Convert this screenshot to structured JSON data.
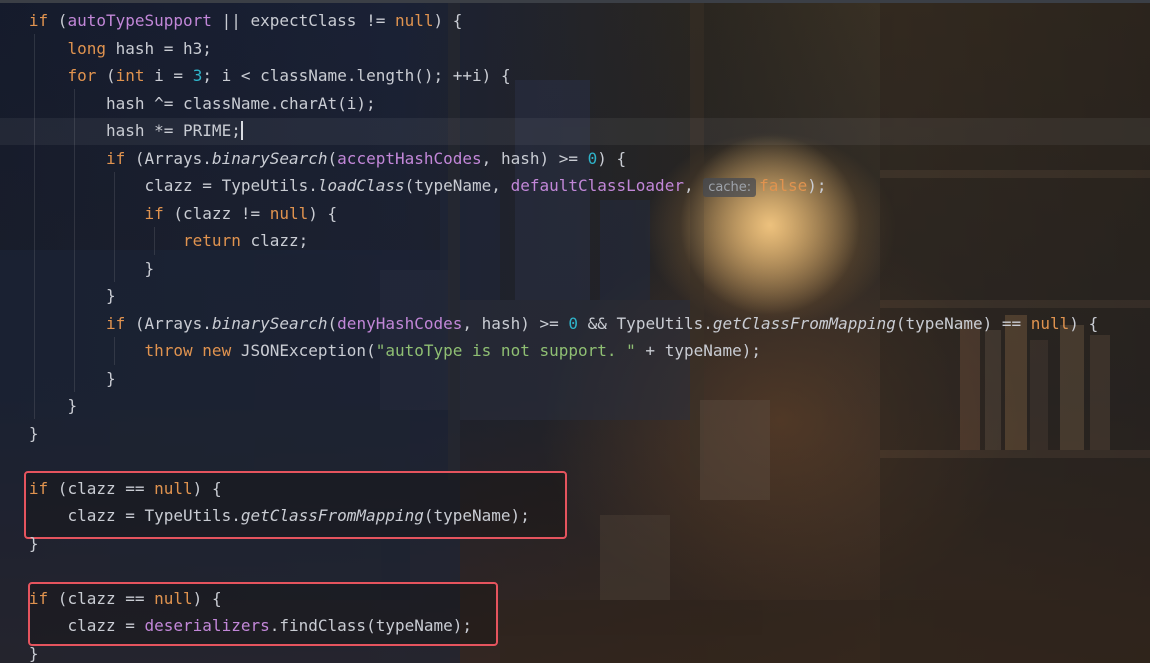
{
  "editor": {
    "highlight_color": "#e5545e",
    "lines": [
      [
        {
          "t": "if",
          "c": "kw"
        },
        {
          "t": " (",
          "c": "plain"
        },
        {
          "t": "autoTypeSupport",
          "c": "fld"
        },
        {
          "t": " || expectClass != ",
          "c": "plain"
        },
        {
          "t": "null",
          "c": "kw"
        },
        {
          "t": ") {",
          "c": "plain"
        }
      ],
      [
        {
          "t": "    ",
          "c": "plain"
        },
        {
          "t": "long",
          "c": "kw"
        },
        {
          "t": " hash = h3;",
          "c": "plain"
        }
      ],
      [
        {
          "t": "    ",
          "c": "plain"
        },
        {
          "t": "for",
          "c": "kw"
        },
        {
          "t": " (",
          "c": "plain"
        },
        {
          "t": "int",
          "c": "kw"
        },
        {
          "t": " i = ",
          "c": "plain"
        },
        {
          "t": "3",
          "c": "num"
        },
        {
          "t": "; i < className.length(); ++i) {",
          "c": "plain"
        }
      ],
      [
        {
          "t": "        hash ^= className.charAt(i);",
          "c": "plain"
        }
      ],
      [
        {
          "t": "        hash *= PRIME;",
          "c": "plain"
        },
        {
          "caret": true
        }
      ],
      [
        {
          "t": "        ",
          "c": "plain"
        },
        {
          "t": "if",
          "c": "kw"
        },
        {
          "t": " (Arrays.",
          "c": "plain"
        },
        {
          "t": "binarySearch",
          "c": "it"
        },
        {
          "t": "(",
          "c": "plain"
        },
        {
          "t": "acceptHashCodes",
          "c": "fld"
        },
        {
          "t": ", hash) >= ",
          "c": "plain"
        },
        {
          "t": "0",
          "c": "num"
        },
        {
          "t": ") {",
          "c": "plain"
        }
      ],
      [
        {
          "t": "            clazz = TypeUtils.",
          "c": "plain"
        },
        {
          "t": "loadClass",
          "c": "it"
        },
        {
          "t": "(typeName, ",
          "c": "plain"
        },
        {
          "t": "defaultClassLoader",
          "c": "fld"
        },
        {
          "t": ", ",
          "c": "plain"
        },
        {
          "hint": "cache:"
        },
        {
          "t": "false",
          "c": "kw"
        },
        {
          "t": ");",
          "c": "plain"
        }
      ],
      [
        {
          "t": "            ",
          "c": "plain"
        },
        {
          "t": "if",
          "c": "kw"
        },
        {
          "t": " (clazz != ",
          "c": "plain"
        },
        {
          "t": "null",
          "c": "kw"
        },
        {
          "t": ") {",
          "c": "plain"
        }
      ],
      [
        {
          "t": "                ",
          "c": "plain"
        },
        {
          "t": "return",
          "c": "kw"
        },
        {
          "t": " clazz;",
          "c": "plain"
        }
      ],
      [
        {
          "t": "            }",
          "c": "plain"
        }
      ],
      [
        {
          "t": "        }",
          "c": "plain"
        }
      ],
      [
        {
          "t": "        ",
          "c": "plain"
        },
        {
          "t": "if",
          "c": "kw"
        },
        {
          "t": " (Arrays.",
          "c": "plain"
        },
        {
          "t": "binarySearch",
          "c": "it"
        },
        {
          "t": "(",
          "c": "plain"
        },
        {
          "t": "denyHashCodes",
          "c": "fld"
        },
        {
          "t": ", hash) >= ",
          "c": "plain"
        },
        {
          "t": "0",
          "c": "num"
        },
        {
          "t": " && TypeUtils.",
          "c": "plain"
        },
        {
          "t": "getClassFromMapping",
          "c": "it"
        },
        {
          "t": "(typeName) == ",
          "c": "plain"
        },
        {
          "t": "null",
          "c": "kw"
        },
        {
          "t": ") {",
          "c": "plain"
        }
      ],
      [
        {
          "t": "            ",
          "c": "plain"
        },
        {
          "t": "throw new",
          "c": "kw"
        },
        {
          "t": " JSONException(",
          "c": "plain"
        },
        {
          "t": "\"autoType is not support. \"",
          "c": "str"
        },
        {
          "t": " + typeName);",
          "c": "plain"
        }
      ],
      [
        {
          "t": "        }",
          "c": "plain"
        }
      ],
      [
        {
          "t": "    }",
          "c": "plain"
        }
      ],
      [
        {
          "t": "}",
          "c": "plain"
        }
      ],
      [],
      [
        {
          "t": "if",
          "c": "kw"
        },
        {
          "t": " (clazz == ",
          "c": "plain"
        },
        {
          "t": "null",
          "c": "kw"
        },
        {
          "t": ") {",
          "c": "plain"
        }
      ],
      [
        {
          "t": "    clazz = TypeUtils.",
          "c": "plain"
        },
        {
          "t": "getClassFromMapping",
          "c": "it"
        },
        {
          "t": "(typeName);",
          "c": "plain"
        }
      ],
      [
        {
          "t": "}",
          "c": "plain"
        }
      ],
      [],
      [
        {
          "t": "if",
          "c": "kw"
        },
        {
          "t": " (clazz == ",
          "c": "plain"
        },
        {
          "t": "null",
          "c": "kw"
        },
        {
          "t": ") {",
          "c": "plain"
        }
      ],
      [
        {
          "t": "    clazz = ",
          "c": "plain"
        },
        {
          "t": "deserializers",
          "c": "fld"
        },
        {
          "t": ".findClass(typeName);",
          "c": "plain"
        }
      ],
      [
        {
          "t": "}",
          "c": "plain"
        }
      ]
    ]
  }
}
